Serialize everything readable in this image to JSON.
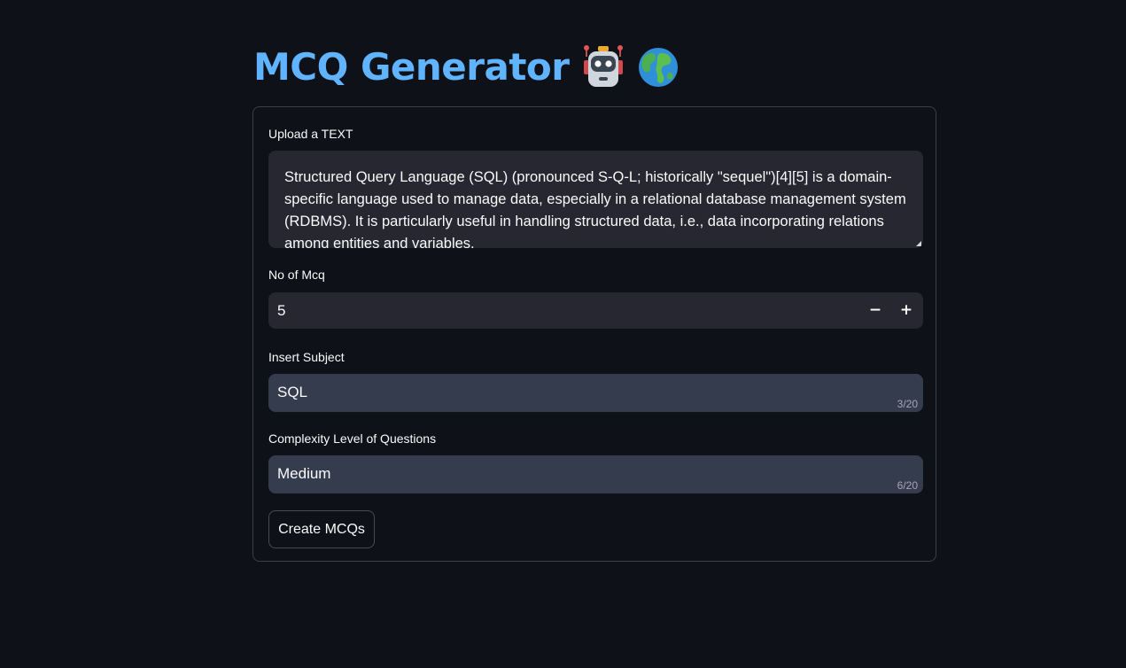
{
  "header": {
    "title": "MCQ Generator",
    "icons": [
      "robot-icon",
      "globe-icon"
    ]
  },
  "form": {
    "text_label": "Upload a TEXT",
    "text_value": "Structured Query Language (SQL) (pronounced S-Q-L; historically \"sequel\")[4][5] is a domain-specific language used to manage data, especially in a relational database management system (RDBMS). It is particularly useful in handling structured data, i.e., data incorporating relations among entities and variables.",
    "mcq_count_label": "No of Mcq",
    "mcq_count_value": "5",
    "stepper_minus": "−",
    "stepper_plus": "+",
    "subject_label": "Insert Subject",
    "subject_value": "SQL",
    "subject_count": "3/20",
    "complexity_label": "Complexity Level of Questions",
    "complexity_value": "Medium",
    "complexity_count": "6/20",
    "submit_label": "Create MCQs"
  },
  "colors": {
    "background": "#0e1117",
    "title": "#60b4ff",
    "input_bg": "#262730",
    "text_input_bg": "#353c4e"
  }
}
